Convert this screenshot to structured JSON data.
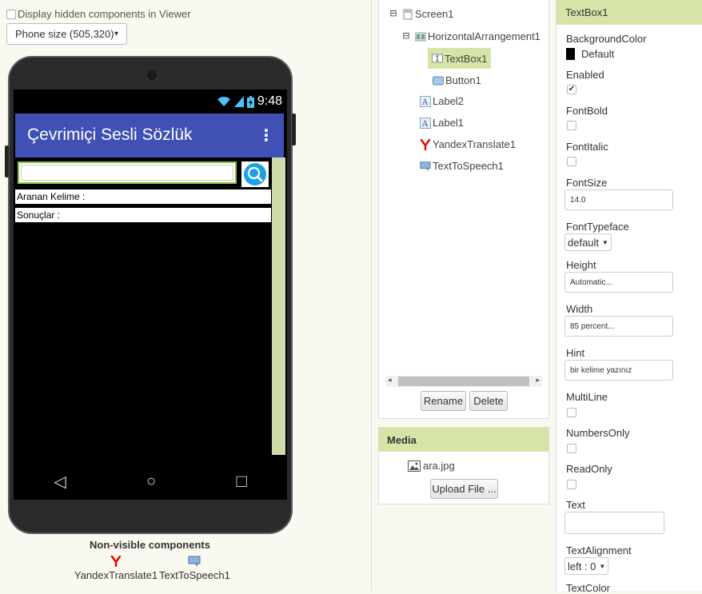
{
  "viewer": {
    "hidden_label": "Display hidden components in Viewer",
    "phone_size": "Phone size (505,320)",
    "status_time": "9:48",
    "app_title": "Çevrimiçi Sesli Sözlük",
    "menu_glyph": "⋮",
    "label2_text": "Aranan Kelime :",
    "label1_text": "Sonuçlar :",
    "nav": {
      "back": "◁",
      "home": "○",
      "recent": "□"
    },
    "nonvisible_title": "Non-visible components",
    "nonvisible": [
      "YandexTranslate1",
      "TextToSpeech1"
    ],
    "colors": {
      "appbar": "#3f51b5",
      "textbox_border": "#8cc63f",
      "strip": "#cddba8"
    }
  },
  "components": {
    "tree": [
      {
        "label": "Screen1",
        "toggle": "⊟"
      },
      {
        "label": "HorizontalArrangement1",
        "toggle": "⊟"
      },
      {
        "label": "TextBox1",
        "selected": true
      },
      {
        "label": "Button1"
      },
      {
        "label": "Label2"
      },
      {
        "label": "Label1"
      },
      {
        "label": "YandexTranslate1"
      },
      {
        "label": "TextToSpeech1"
      }
    ],
    "rename_label": "Rename",
    "delete_label": "Delete",
    "selected_color": "#d6e5a7"
  },
  "media": {
    "title": "Media",
    "file": "ara.jpg",
    "upload_label": "Upload File ..."
  },
  "properties": {
    "title": "TextBox1",
    "BackgroundColor": {
      "label": "BackgroundColor",
      "value": "Default",
      "swatch": "#000000"
    },
    "Enabled": {
      "label": "Enabled",
      "checked": true
    },
    "FontBold": {
      "label": "FontBold",
      "checked": false
    },
    "FontItalic": {
      "label": "FontItalic",
      "checked": false
    },
    "FontSize": {
      "label": "FontSize",
      "value": "14.0"
    },
    "FontTypeface": {
      "label": "FontTypeface",
      "value": "default"
    },
    "Height": {
      "label": "Height",
      "value": "Automatic..."
    },
    "Width": {
      "label": "Width",
      "value": "85 percent..."
    },
    "Hint": {
      "label": "Hint",
      "value": "bir kelime yazınız"
    },
    "MultiLine": {
      "label": "MultiLine",
      "checked": false
    },
    "NumbersOnly": {
      "label": "NumbersOnly",
      "checked": false
    },
    "ReadOnly": {
      "label": "ReadOnly",
      "checked": false
    },
    "Text": {
      "label": "Text",
      "value": ""
    },
    "TextAlignment": {
      "label": "TextAlignment",
      "value": "left : 0"
    },
    "TextColor": {
      "label": "TextColor"
    }
  }
}
